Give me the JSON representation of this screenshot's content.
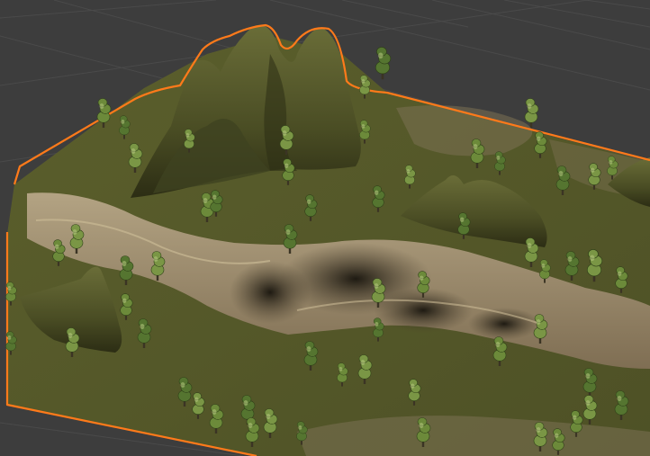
{
  "viewport": {
    "type": "3d-viewport",
    "background_color": "#3d3d3d",
    "grid_color": "#4a4a4a",
    "selection_outline_color": "#ff7a1a"
  },
  "terrain": {
    "selected": true,
    "grass_color": "#55582a",
    "rock_color": "#9d8a6c",
    "mountain_color": "#4e5226",
    "features": [
      "mountain-range",
      "rocky-canyon",
      "hill",
      "trees"
    ]
  },
  "tree_icon": "conifer-tree-icon"
}
